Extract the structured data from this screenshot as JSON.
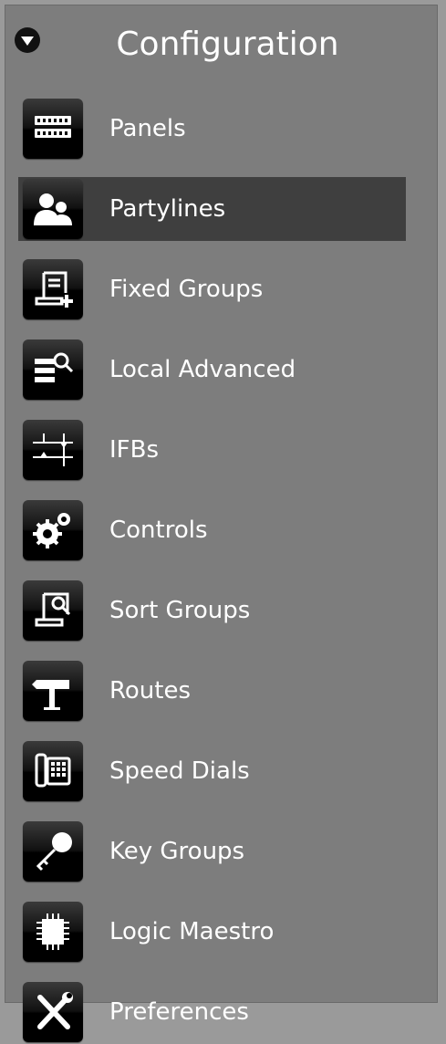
{
  "header": {
    "title": "Configuration"
  },
  "menu": {
    "items": [
      {
        "label": "Panels",
        "icon": "panels-icon",
        "selected": false
      },
      {
        "label": "Partylines",
        "icon": "partylines-icon",
        "selected": true
      },
      {
        "label": "Fixed Groups",
        "icon": "fixed-groups-icon",
        "selected": false
      },
      {
        "label": "Local Advanced",
        "icon": "local-advanced-icon",
        "selected": false
      },
      {
        "label": "IFBs",
        "icon": "ifbs-icon",
        "selected": false
      },
      {
        "label": "Controls",
        "icon": "gears-icon",
        "selected": false
      },
      {
        "label": "Sort Groups",
        "icon": "sort-groups-icon",
        "selected": false
      },
      {
        "label": "Routes",
        "icon": "signpost-icon",
        "selected": false
      },
      {
        "label": "Speed Dials",
        "icon": "phone-icon",
        "selected": false
      },
      {
        "label": "Key Groups",
        "icon": "key-icon",
        "selected": false
      },
      {
        "label": "Logic Maestro",
        "icon": "chip-icon",
        "selected": false
      },
      {
        "label": "Preferences",
        "icon": "tools-icon",
        "selected": false
      }
    ]
  },
  "colors": {
    "panel": "#7d7d7d",
    "selected": "#3f3f3f",
    "text": "#ffffff"
  }
}
